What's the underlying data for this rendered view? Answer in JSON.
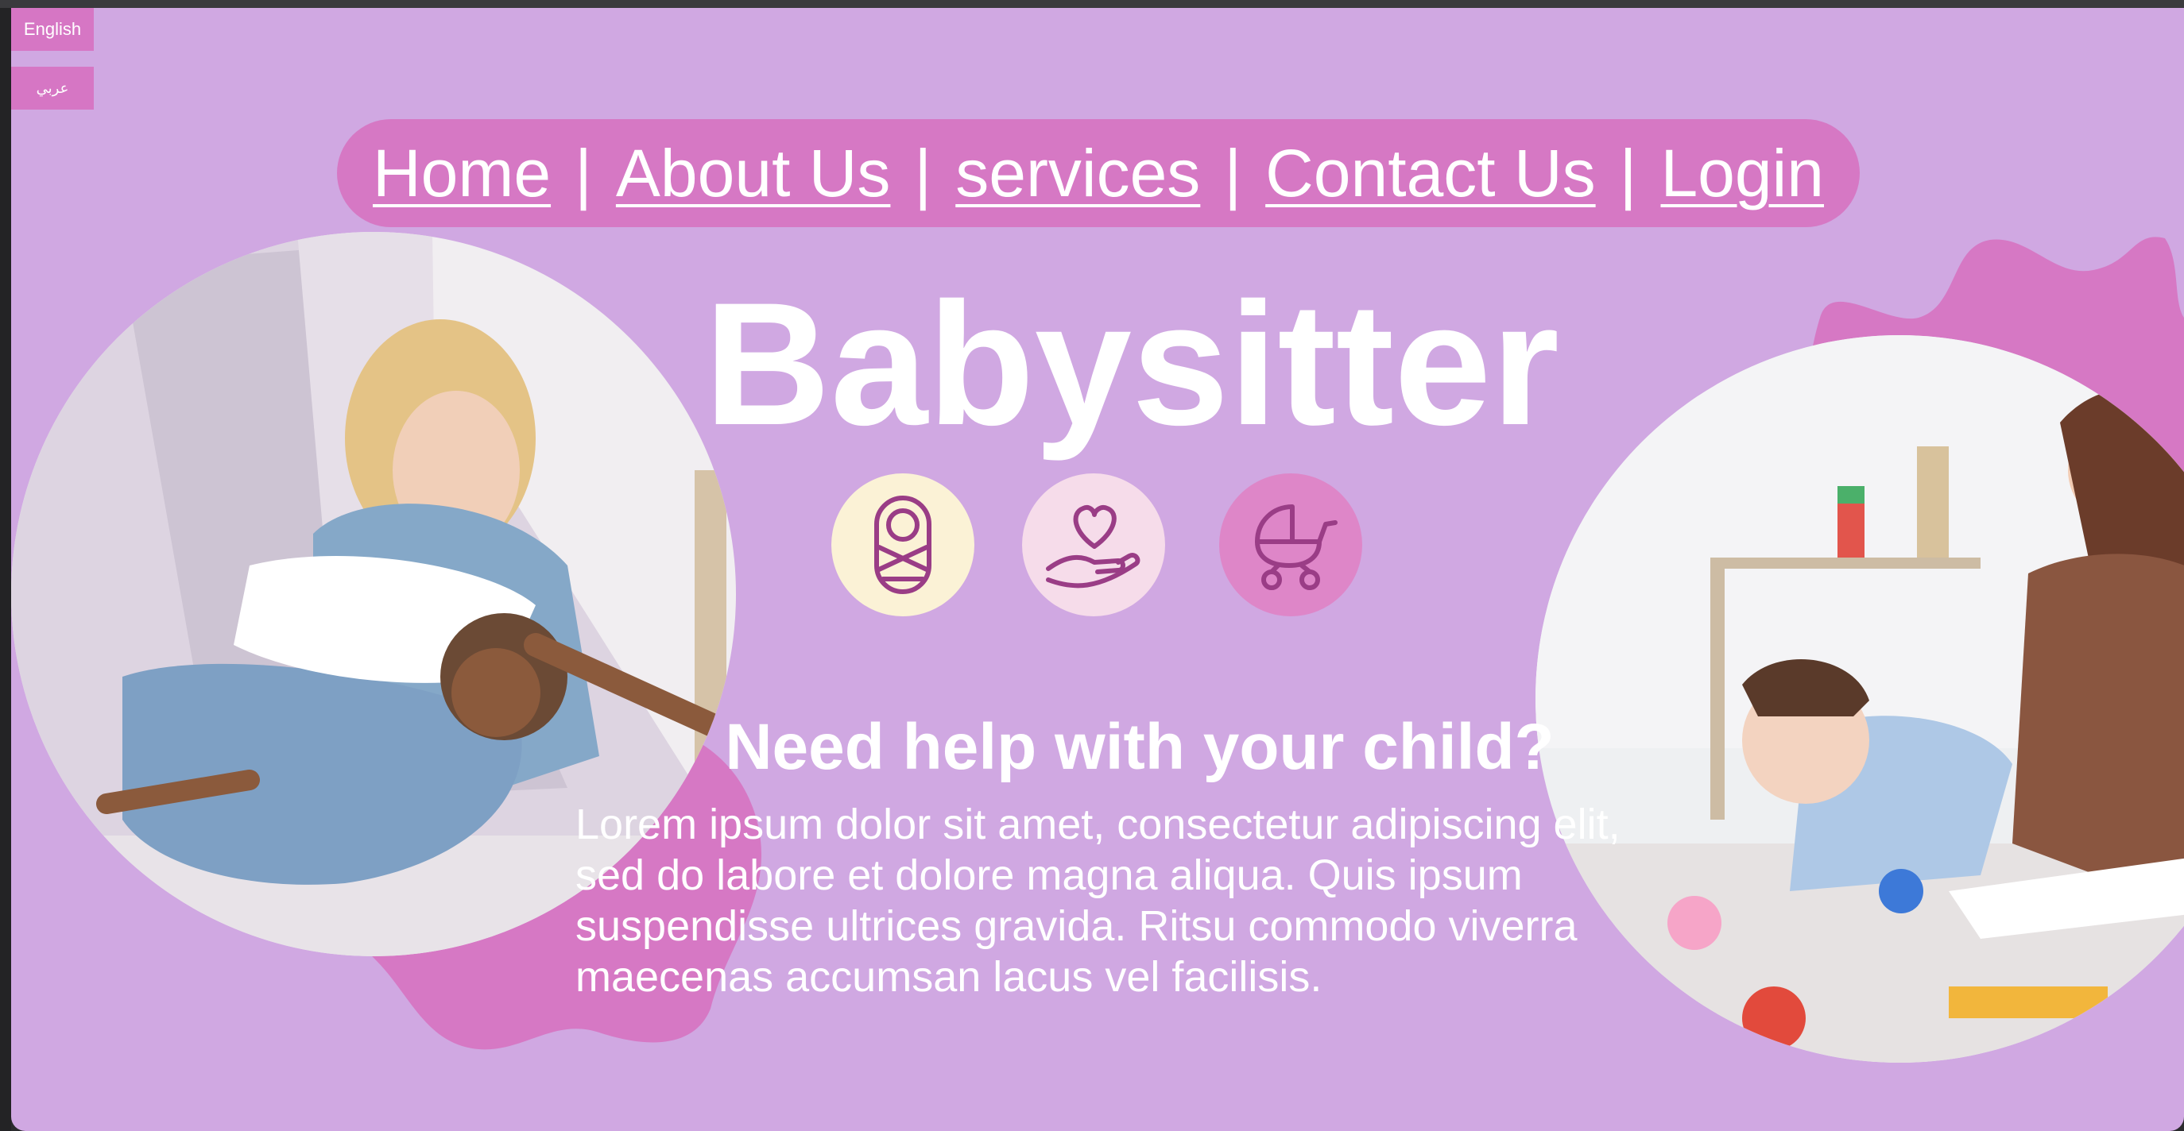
{
  "language_switcher": {
    "english_label": "English",
    "arabic_label": "عربي"
  },
  "nav": {
    "items": [
      {
        "label": "Home"
      },
      {
        "label": "About Us"
      },
      {
        "label": "services"
      },
      {
        "label": "Contact Us"
      },
      {
        "label": "Login"
      }
    ],
    "separator": "|"
  },
  "hero": {
    "title": "Babysitter",
    "icons": [
      {
        "name": "swaddled-baby-icon",
        "bg": "#fbf2d6"
      },
      {
        "name": "heart-in-hand-icon",
        "bg": "#f6dcea"
      },
      {
        "name": "baby-stroller-icon",
        "bg": "#de86c8"
      }
    ],
    "subtitle": "Need help with your child?",
    "paragraph": "Lorem ipsum dolor sit amet, consectetur adipiscing elit, sed do labore et dolore magna aliqua. Quis ipsum suspendisse ultrices gravida. Ritsu commodo viverra maecenas accumsan lacus vel facilisis."
  },
  "images": {
    "left_photo": "photo-mother-playing-with-child",
    "right_photo": "photo-woman-and-girl-drawing"
  },
  "colors": {
    "page_bg": "#d0a8e2",
    "accent": "#d678c4",
    "icon_stroke": "#9a3d86"
  }
}
